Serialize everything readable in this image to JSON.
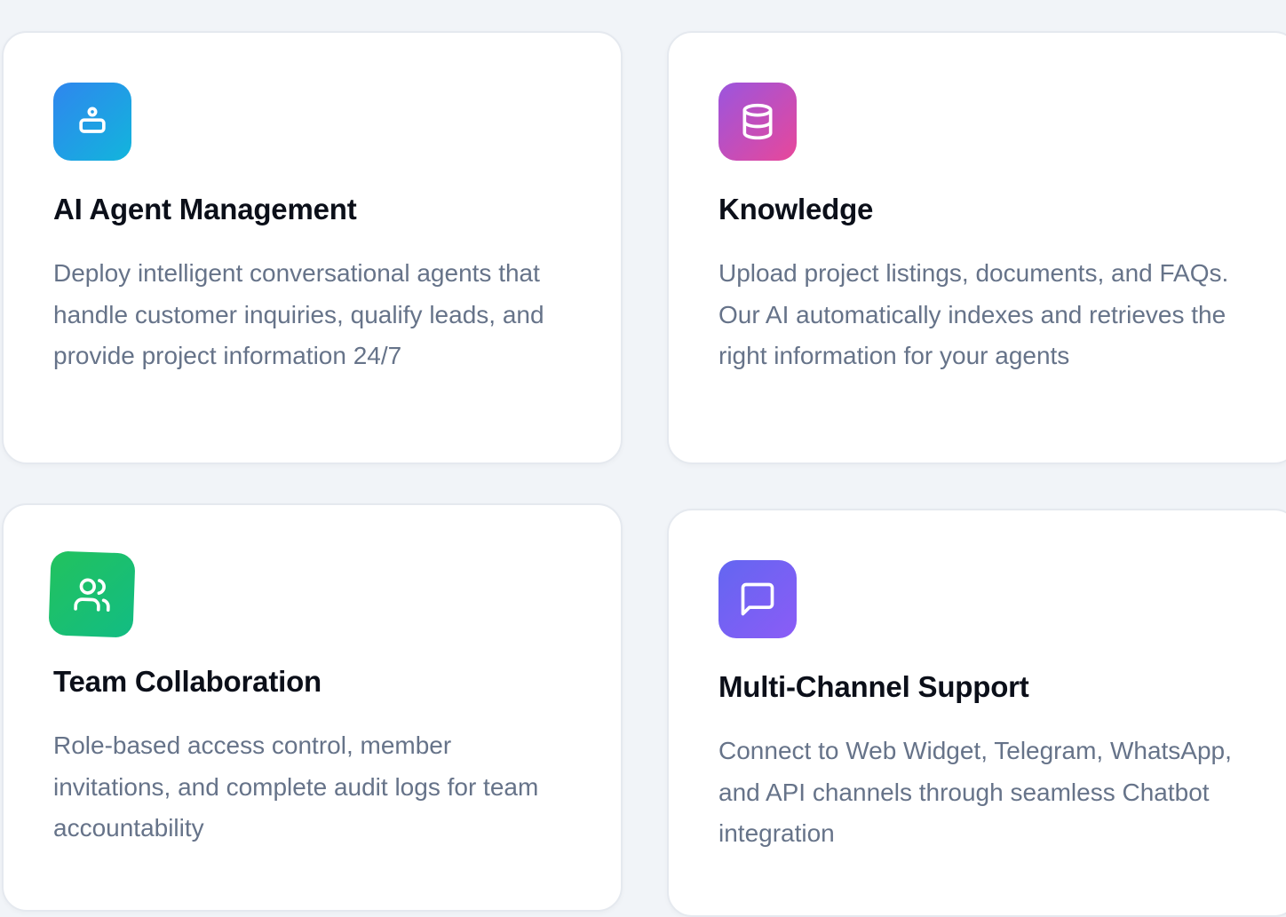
{
  "features": [
    {
      "title": "AI Agent Management",
      "description": "Deploy intelligent conversational agents that handle customer inquiries, qualify leads, and provide project information 24/7",
      "icon": "agent-icon",
      "gradient": [
        "#2f86ee",
        "#12b5dc"
      ]
    },
    {
      "title": "Knowledge",
      "description": "Upload project listings, documents, and FAQs. Our AI automatically indexes and retrieves the right information for your agents",
      "icon": "database-icon",
      "gradient": [
        "#9b55de",
        "#e8479a"
      ]
    },
    {
      "title": "Team Collaboration",
      "description": "Role-based access control, member invitations, and complete audit logs for team accountability",
      "icon": "users-icon",
      "gradient": [
        "#22c25e",
        "#12bc83"
      ]
    },
    {
      "title": "Multi-Channel Support",
      "description": "Connect to Web Widget, Telegram, WhatsApp, and API channels through seamless Chatbot integration",
      "icon": "message-square-icon",
      "gradient": [
        "#6366f1",
        "#8b5cf6"
      ]
    }
  ],
  "colors": {
    "background": "#f1f4f8",
    "card": "#ffffff",
    "title": "#0b0f19",
    "description": "#667389"
  }
}
